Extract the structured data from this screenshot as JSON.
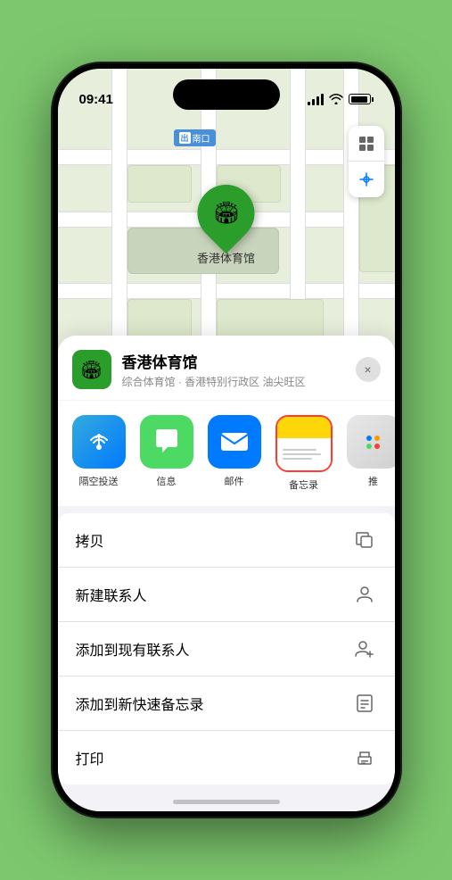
{
  "status_bar": {
    "time": "09:41",
    "location_arrow": "▶"
  },
  "map": {
    "south_exit_num": "出",
    "south_exit_label": "南口",
    "venue_pin_emoji": "🏟",
    "venue_name_on_map": "香港体育馆"
  },
  "sheet": {
    "venue_name": "香港体育馆",
    "venue_subtitle": "综合体育馆 · 香港特别行政区 油尖旺区",
    "close_label": "×"
  },
  "share_items": [
    {
      "label": "隔空投送",
      "type": "airdrop"
    },
    {
      "label": "信息",
      "type": "messages"
    },
    {
      "label": "邮件",
      "type": "mail"
    },
    {
      "label": "备忘录",
      "type": "notes"
    },
    {
      "label": "推",
      "type": "more"
    }
  ],
  "actions": [
    {
      "label": "拷贝",
      "icon": "copy"
    },
    {
      "label": "新建联系人",
      "icon": "person"
    },
    {
      "label": "添加到现有联系人",
      "icon": "person-add"
    },
    {
      "label": "添加到新快速备忘录",
      "icon": "note"
    },
    {
      "label": "打印",
      "icon": "print"
    }
  ]
}
